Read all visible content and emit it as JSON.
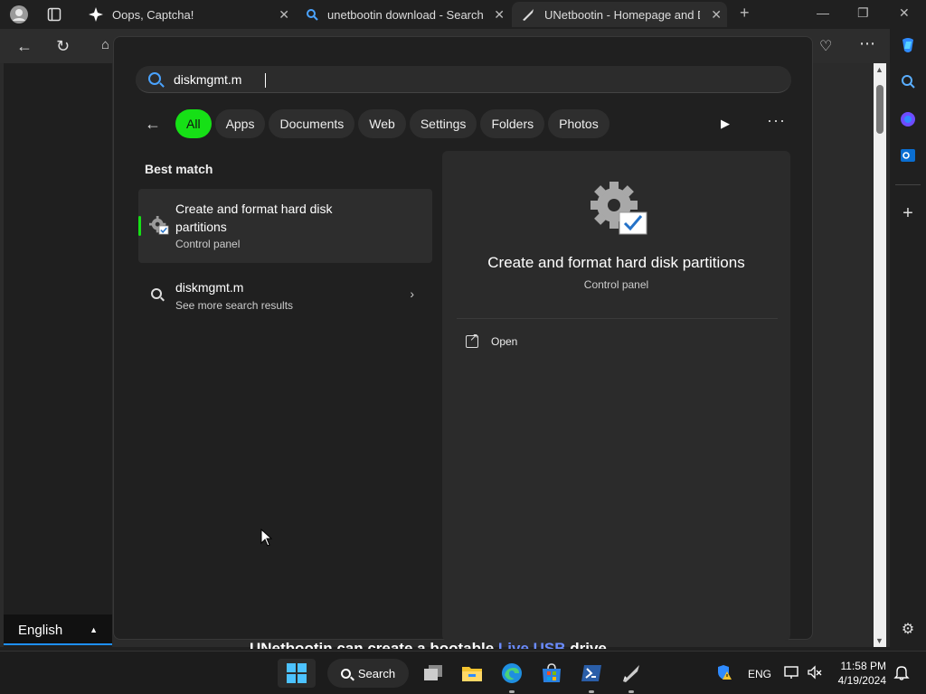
{
  "browser": {
    "tabs": [
      {
        "title": "Oops, Captcha!",
        "icon": "sparkle-icon"
      },
      {
        "title": "unetbootin download - Search",
        "icon": "search-icon"
      },
      {
        "title": "UNetbootin - Homepage and Do",
        "icon": "unetbootin-icon"
      }
    ]
  },
  "start_search": {
    "query": "diskmgmt.m",
    "filters": [
      "All",
      "Apps",
      "Documents",
      "Web",
      "Settings",
      "Folders",
      "Photos"
    ],
    "active_filter": "All",
    "best_match_label": "Best match",
    "best_match": {
      "title": "Create and format hard disk partitions",
      "subtitle": "Control panel"
    },
    "more_results": {
      "title": "diskmgmt.m",
      "subtitle": "See more search results"
    },
    "preview": {
      "title": "Create and format hard disk partitions",
      "subtitle": "Control panel",
      "actions": [
        "Open"
      ]
    }
  },
  "page": {
    "language": "English",
    "text_prefix": "UNetbootin can create a bootable ",
    "text_link": "Live USB",
    "text_suffix": " drive"
  },
  "taskbar": {
    "search_label": "Search",
    "language": "ENG",
    "time": "11:58 PM",
    "date": "4/19/2024"
  },
  "colors": {
    "accent_green": "#16e016",
    "search_blue": "#4aa3ff",
    "windows_blue": "#4cc2ff"
  }
}
